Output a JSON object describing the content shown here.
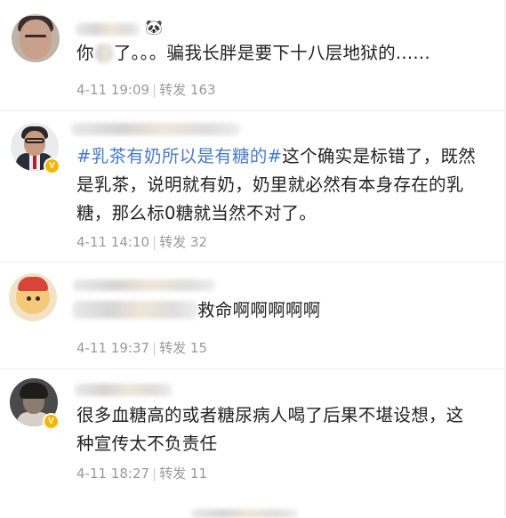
{
  "comments": [
    {
      "line1_visible": "了。。。骗我长胖是要下十八层地狱的......",
      "line1_prefix": "你",
      "date": "4-11 19:09",
      "repost_label": "转发",
      "repost_count": "163",
      "emoji": "🐼"
    },
    {
      "hashtag": "#乳茶有奶所以是有糖的#",
      "line1_rest": "这个确实是标错了，既然",
      "line2": "是乳茶，说明就有奶，奶里就必然有本身存在的乳",
      "line3": "糖，那么标0糖就当然不对了。",
      "date": "4-11 14:10",
      "repost_label": "转发",
      "repost_count": "32"
    },
    {
      "line1_visible": "救命啊啊啊啊啊",
      "date": "4-11 19:37",
      "repost_label": "转发",
      "repost_count": "15"
    },
    {
      "line1": "很多血糖高的或者糖尿病人喝了后果不堪设想，这",
      "line2": "种宣传太不负责任",
      "date": "4-11 18:27",
      "repost_label": "转发",
      "repost_count": "11"
    }
  ],
  "separator": "|",
  "verified_badge": "V",
  "colors": {
    "hashtag": "#4a7bc8",
    "meta_text": "#9a9a9a",
    "body_text": "#222222",
    "verified": "#f7b500"
  },
  "icons": [
    "verified-badge-icon",
    "panda-emoji-icon"
  ]
}
